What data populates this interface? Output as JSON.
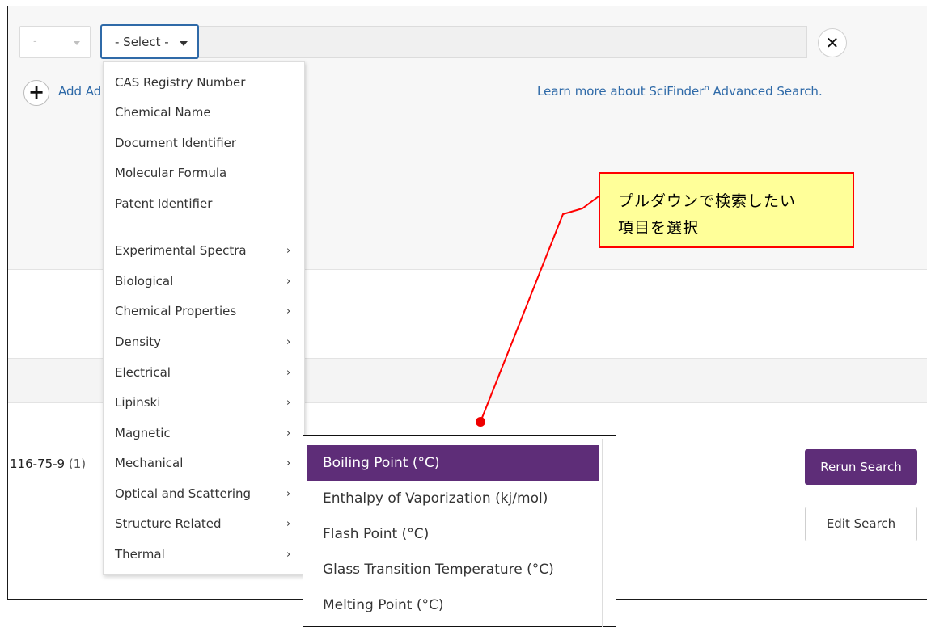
{
  "search_row": {
    "operator_value": "-",
    "field_select_label": "- Select -",
    "search_value": ""
  },
  "add_link": "Add Ad",
  "learn_more": {
    "text": "Learn more about SciFinder",
    "sup": "n",
    "tail": " Advanced Search."
  },
  "result": {
    "id": "116-75-9",
    "count": "(1)"
  },
  "buttons": {
    "rerun": "Rerun Search",
    "edit": "Edit Search"
  },
  "field_menu": {
    "basic_items": [
      "CAS Registry Number",
      "Chemical Name",
      "Document Identifier",
      "Molecular Formula",
      "Patent Identifier"
    ],
    "property_items": [
      "Experimental Spectra",
      "Biological",
      "Chemical Properties",
      "Density",
      "Electrical",
      "Lipinski",
      "Magnetic",
      "Mechanical",
      "Optical and Scattering",
      "Structure Related",
      "Thermal"
    ],
    "arrow": "›"
  },
  "thermal_submenu": {
    "items": [
      "Boiling Point (°C)",
      "Enthalpy of Vaporization (kj/mol)",
      "Flash Point (°C)",
      "Glass Transition Temperature (°C)",
      "Melting Point (°C)"
    ],
    "active_index": 0
  },
  "callout": {
    "line1": "プルダウンで検索したい",
    "line2": "項目を選択"
  },
  "icons": {
    "close": "✕",
    "add": "+"
  },
  "colors": {
    "accent_purple": "#5e2d78",
    "link_blue": "#2f6aa8",
    "callout_fill": "#ffff99",
    "callout_border": "#ff0000"
  }
}
